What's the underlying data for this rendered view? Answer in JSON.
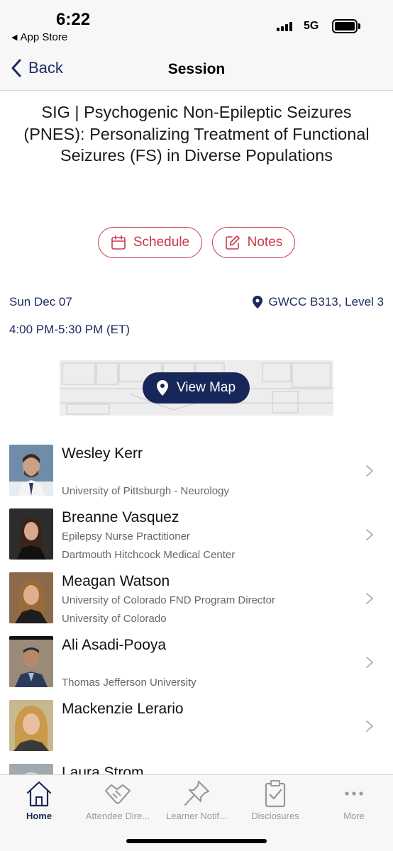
{
  "status_bar": {
    "time": "6:22",
    "back_app": "App Store",
    "network": "5G"
  },
  "nav": {
    "back_label": "Back",
    "title": "Session"
  },
  "session": {
    "title": "SIG | Psychogenic Non-Epileptic Seizures (PNES): Personalizing Treatment of Functional Seizures (FS) in Diverse Populations",
    "schedule_label": "Schedule",
    "notes_label": "Notes",
    "date": "Sun Dec 07",
    "location": "GWCC B313, Level 3",
    "time_range": "4:00 PM-5:30 PM (ET)",
    "view_map_label": "View Map"
  },
  "speakers": [
    {
      "name": "Wesley Kerr",
      "line1": "",
      "line2": "University of Pittsburgh - Neurology"
    },
    {
      "name": "Breanne Vasquez",
      "line1": "Epilepsy Nurse Practitioner",
      "line2": "Dartmouth Hitchcock Medical Center"
    },
    {
      "name": "Meagan Watson",
      "line1": "University of Colorado FND Program Director",
      "line2": "University of Colorado"
    },
    {
      "name": "Ali Asadi-Pooya",
      "line1": "",
      "line2": "Thomas Jefferson University"
    },
    {
      "name": "Mackenzie Lerario",
      "line1": "",
      "line2": ""
    },
    {
      "name": "Laura Strom",
      "line1": "",
      "line2": ""
    }
  ],
  "tabs": [
    {
      "label": "Home",
      "icon": "home-icon",
      "active": true
    },
    {
      "label": "Attendee Dire...",
      "icon": "handshake-icon",
      "active": false
    },
    {
      "label": "Learner Notif...",
      "icon": "pushpin-icon",
      "active": false
    },
    {
      "label": "Disclosures",
      "icon": "clipboard-check-icon",
      "active": false
    },
    {
      "label": "More",
      "icon": "more-dots-icon",
      "active": false
    }
  ],
  "colors": {
    "navy": "#1b2a5e",
    "accent_red": "#c8394a",
    "map_button": "#17275a"
  }
}
